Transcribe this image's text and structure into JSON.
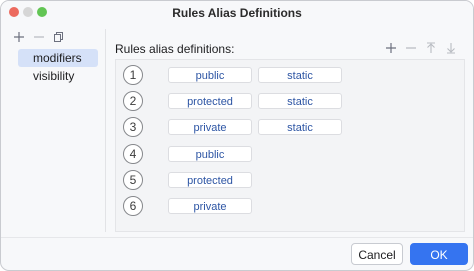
{
  "window": {
    "title": "Rules Alias Definitions",
    "colors": {
      "close": "#ec6a5e",
      "minimize": "#d6d6d6",
      "maximize": "#62c554",
      "accent": "#3574f0",
      "chip_text": "#2d55a4"
    }
  },
  "left_toolbar": {
    "add_icon": "plus-icon",
    "remove_icon": "minus-icon",
    "copy_icon": "copy-icon"
  },
  "sidebar": {
    "items": [
      {
        "label": "modifiers",
        "selected": true
      },
      {
        "label": "visibility",
        "selected": false
      }
    ]
  },
  "main": {
    "label": "Rules alias definitions:",
    "toolbar": {
      "add_icon": "plus-icon",
      "remove_icon": "minus-icon",
      "up_icon": "arrow-up-icon",
      "down_icon": "arrow-down-icon"
    },
    "rules": [
      {
        "number": "1",
        "chips": [
          "public",
          "static"
        ]
      },
      {
        "number": "2",
        "chips": [
          "protected",
          "static"
        ]
      },
      {
        "number": "3",
        "chips": [
          "private",
          "static"
        ]
      },
      {
        "number": "4",
        "chips": [
          "public"
        ]
      },
      {
        "number": "5",
        "chips": [
          "protected"
        ]
      },
      {
        "number": "6",
        "chips": [
          "private"
        ]
      }
    ]
  },
  "footer": {
    "cancel_label": "Cancel",
    "ok_label": "OK"
  }
}
